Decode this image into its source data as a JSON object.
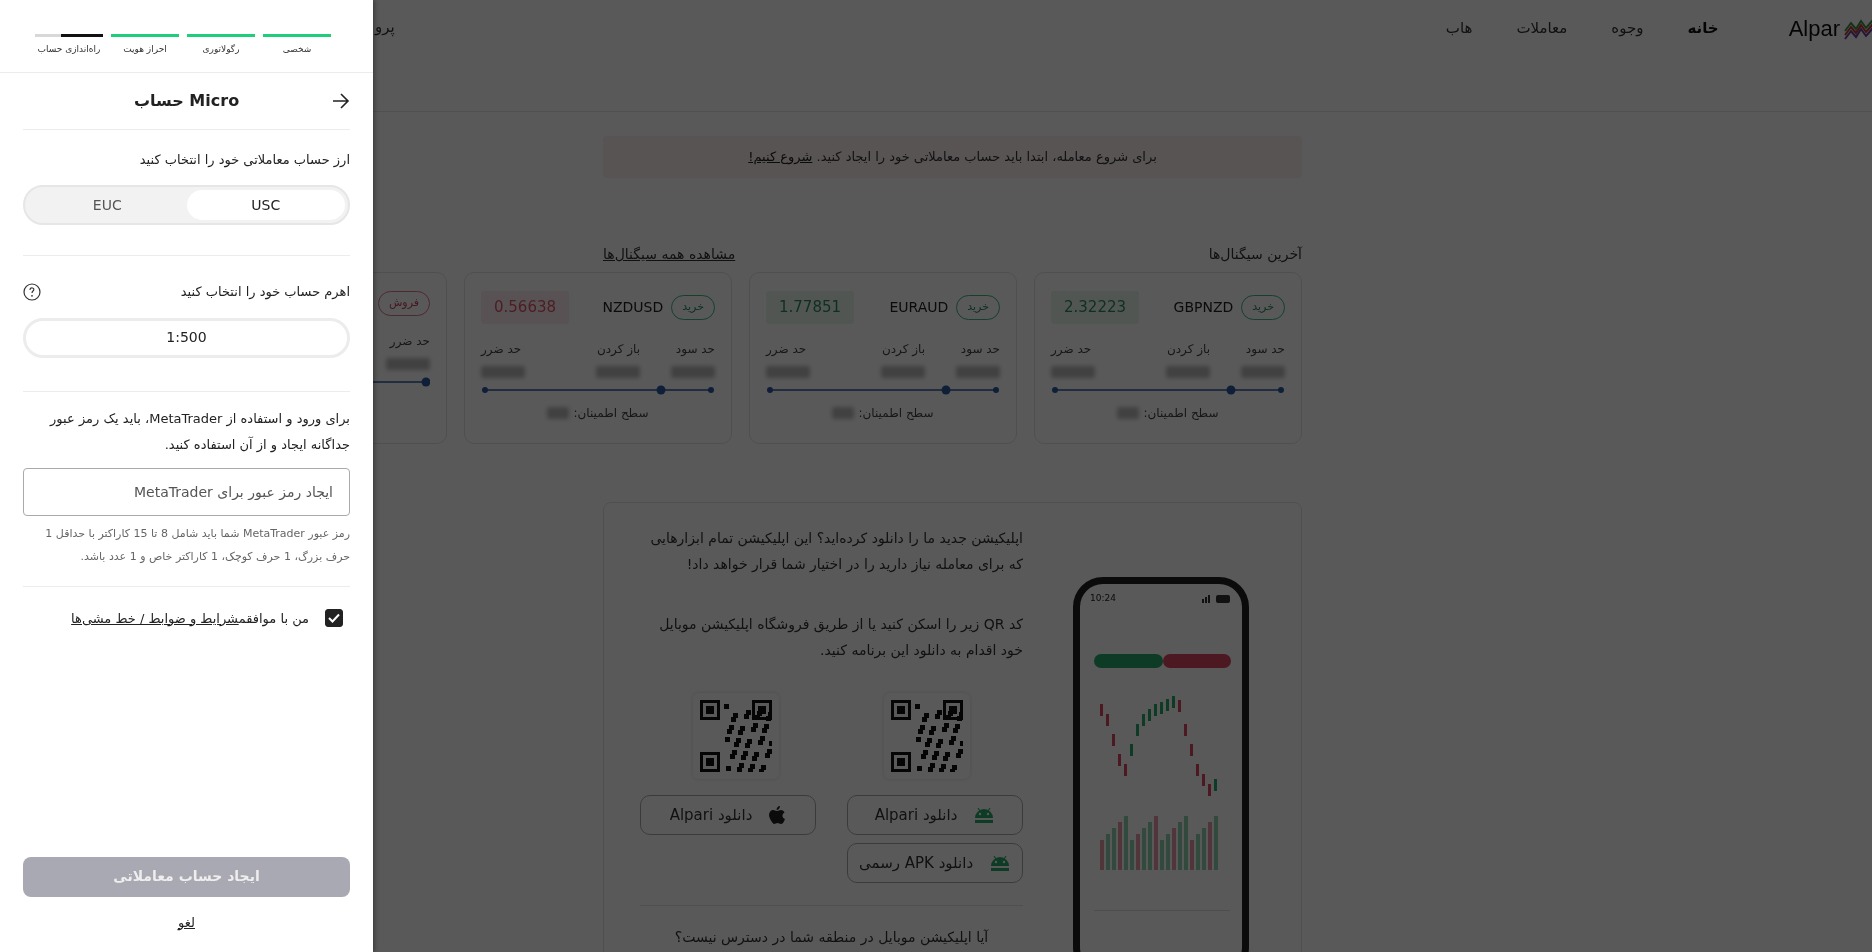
{
  "page": {
    "logo": "Alpar",
    "nav": [
      {
        "label": "خانه",
        "selected": true
      },
      {
        "label": "وجوه",
        "selected": false
      },
      {
        "label": "معاملات",
        "selected": false
      },
      {
        "label": "هاب",
        "selected": false
      }
    ],
    "nav_cut": "پرو",
    "alert": {
      "text": "برای شروع معامله، ابتدا باید حساب معاملاتی خود را ایجاد کنید.",
      "link": "شروع کنیم!"
    },
    "signals": {
      "title": "آخرین سیگنال‌ها",
      "view_all": "مشاهده همه سیگنال‌ها",
      "cards": [
        {
          "action": "خرید",
          "kind": "buy",
          "pair": "GBPNZD",
          "price": {
            "value": "2.32223",
            "kind": "up"
          },
          "labels": [
            "حد سود",
            "باز کردن",
            "حد ضرر"
          ],
          "confidence": "سطح اطمینان:"
        },
        {
          "action": "خرید",
          "kind": "buy",
          "pair": "EURAUD",
          "price": {
            "value": "1.77851",
            "kind": "up"
          },
          "labels": [
            "حد سود",
            "باز کردن",
            "حد ضرر"
          ],
          "confidence": "سطح اطمینان:"
        },
        {
          "action": "خرید",
          "kind": "buy",
          "pair": "NZDUSD",
          "price": {
            "value": "0.56638",
            "kind": "down"
          },
          "labels": [
            "حد سود",
            "باز کردن",
            "حد ضرر"
          ],
          "confidence": "سطح اطمینان:"
        },
        {
          "action": "فروش",
          "kind": "sell",
          "labels": [
            "حد ضرر"
          ]
        }
      ]
    },
    "app": {
      "intro": "اپلیکیشن جدید ما را دانلود کرده‌اید؟ این اپلیکیشن تمام ابزارهایی که برای معامله نیاز دارید را در اختیار شما قرار خواهد داد!",
      "qr_text": "کد QR زیر را اسکن کنید یا از طریق فروشگاه اپلیکیشن موبایل خود اقدام به دانلود این برنامه کنید.",
      "buttons": [
        {
          "label": "دانلود Alpari",
          "kind": "android"
        },
        {
          "label": "دانلود Alpari",
          "kind": "apple"
        },
        {
          "label": "دانلود APK رسمی",
          "kind": "android"
        }
      ],
      "question": "آیا اپلیکیشن موبایل در منطقه شما در دسترس نیست؟",
      "phone_time": "10:24"
    }
  },
  "drawer": {
    "steps": [
      {
        "label": "شخصی",
        "selected": false,
        "level": 1
      },
      {
        "label": "رگولاتوری",
        "selected": false,
        "level": 1
      },
      {
        "label": "احراز هویت",
        "selected": false,
        "level": 1
      },
      {
        "label": "راه‌اندازی حساب",
        "selected": true,
        "level": 0.62
      }
    ],
    "title": "Micro حساب",
    "currency": {
      "label": "ارز حساب معاملاتی خود را انتخاب کنید",
      "options": [
        {
          "label": "USC",
          "selected": true
        },
        {
          "label": "EUC",
          "selected": false
        }
      ]
    },
    "leverage": {
      "label": "اهرم حساب خود را انتخاب کنید",
      "value": "1:500"
    },
    "password": {
      "intro": "برای ورود و استفاده از MetaTrader، باید یک رمز عبور جداگانه ایجاد و از آن استفاده کنید.",
      "placeholder": "ایجاد رمز عبور برای MetaTrader",
      "hint": "رمز عبور MetaTrader شما باید شامل 8 تا 15 کاراکتر با حداقل 1 حرف بزرگ، 1 حرف کوچک، 1 کاراکتر خاص و 1 عدد باشد."
    },
    "terms": {
      "text": "من با موافقم",
      "link": "شرایط و ضوابط / خط مشی‌ها",
      "checked": true
    },
    "submit": {
      "label": "ایجاد حساب معاملاتی",
      "disabled": true
    },
    "cancel": "لغو"
  }
}
